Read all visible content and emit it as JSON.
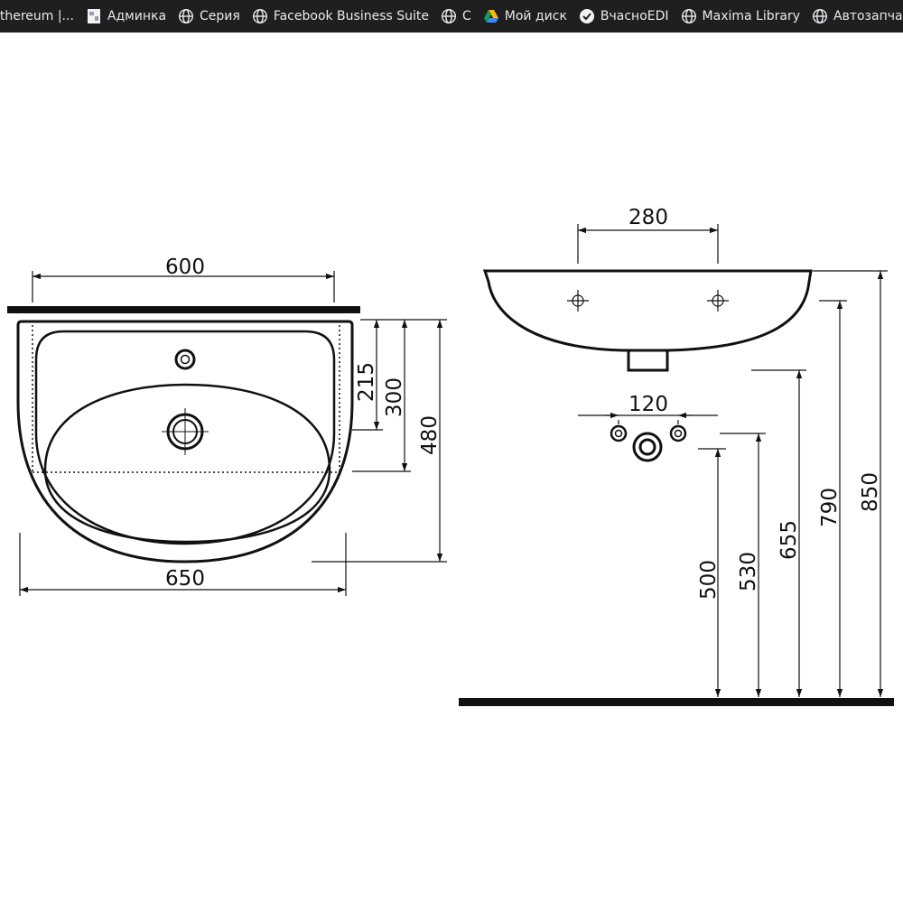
{
  "bookmarks": [
    {
      "label": "Ethereum |...",
      "icon": "none"
    },
    {
      "label": "Админка",
      "icon": "page-icon"
    },
    {
      "label": "Серия",
      "icon": "globe-icon"
    },
    {
      "label": "Facebook Business Suite",
      "icon": "globe-icon"
    },
    {
      "label": "С",
      "icon": "globe-icon"
    },
    {
      "label": "Мой диск",
      "icon": "google-drive-icon"
    },
    {
      "label": "ВчасноEDI",
      "icon": "vchasno-icon"
    },
    {
      "label": "Maxima Library",
      "icon": "globe-icon"
    },
    {
      "label": "Автозапчасти",
      "icon": "globe-icon"
    }
  ],
  "drawing": {
    "front_view": {
      "dim_600": "600",
      "dim_650": "650",
      "dim_215": "215",
      "dim_300": "300",
      "dim_480": "480"
    },
    "side_view": {
      "dim_280": "280",
      "dim_120": "120",
      "dim_500": "500",
      "dim_530": "530",
      "dim_655": "655",
      "dim_790": "790",
      "dim_850": "850"
    }
  },
  "colors": {
    "toolbar_bg": "#1f1f1f",
    "toolbar_text": "#e8eaed",
    "line": "#111111"
  }
}
